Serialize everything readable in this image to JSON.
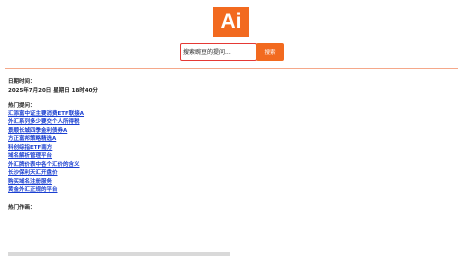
{
  "logo": {
    "text": "Ai"
  },
  "search": {
    "placeholder": "搜索豌豆的提问...",
    "button_label": "搜索"
  },
  "datetime": {
    "label": "日期时间：",
    "value": "2025年7月20日 星期日 18时40分"
  },
  "hot_questions": {
    "label": "热门提问：",
    "items": [
      "汇添富中证主要消费ETF联接A",
      "外汇系列多少要交个人所得税",
      "景顺长城四季金利债券A",
      "方正富邦策略精选A",
      "科创综指ETF南方",
      "域名解析管理平台",
      "外汇牌价表中各个汇价的含义",
      "长沙保利天汇开盘价",
      "购买域名注册服务",
      "黄金外汇正规的平台"
    ]
  },
  "hot_works": {
    "label": "热门作画："
  }
}
